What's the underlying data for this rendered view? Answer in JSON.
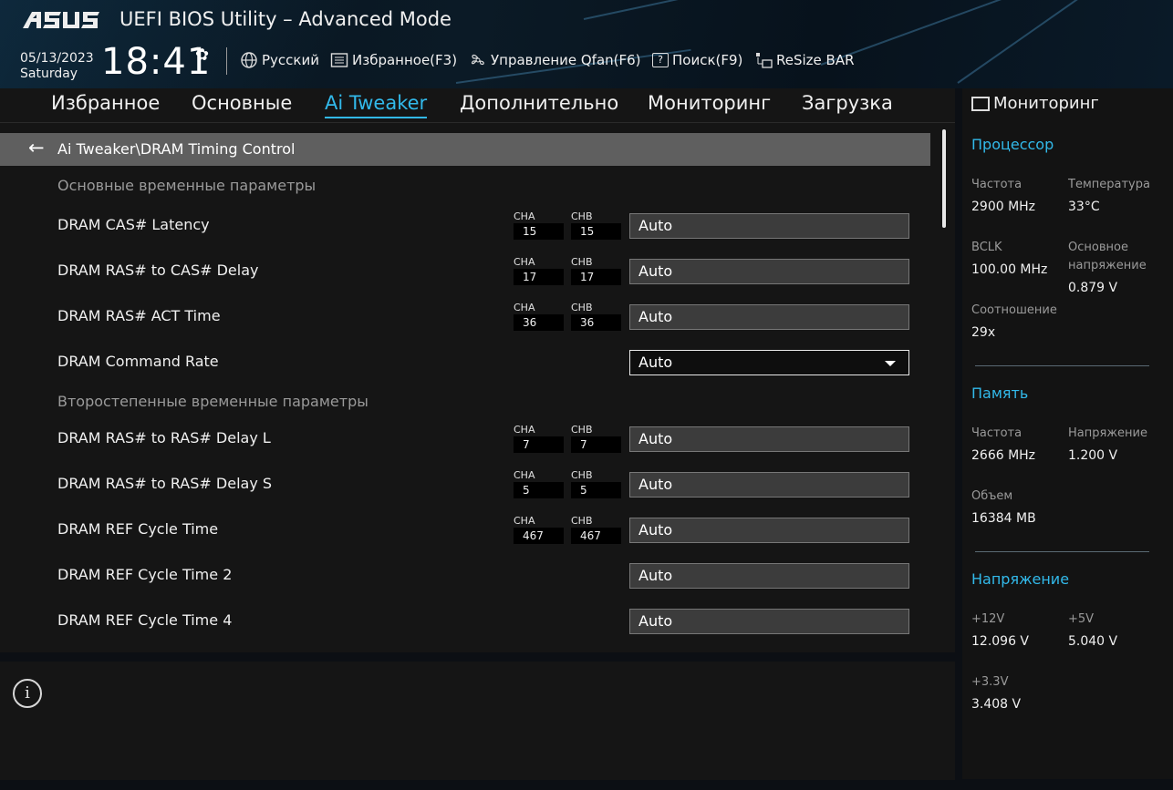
{
  "header": {
    "logo": "/ISUS",
    "title": "UEFI BIOS Utility – Advanced Mode",
    "date": "05/13/2023",
    "day": "Saturday",
    "time": "18:41",
    "tools": {
      "language": "Русский",
      "favorites": "Избранное(F3)",
      "qfan": "Управление Qfan(F6)",
      "search": "Поиск(F9)",
      "resizebar": "ReSize BAR"
    }
  },
  "tabs": [
    "Избранное",
    "Основные",
    "Ai Tweaker",
    "Дополнительно",
    "Мониторинг",
    "Загрузка"
  ],
  "active_tab": "Ai Tweaker",
  "breadcrumb": "Ai Tweaker\\DRAM Timing Control",
  "sections": {
    "primary": "Основные временные параметры",
    "secondary": "Второстепенные временные параметры"
  },
  "rows": [
    {
      "label": "DRAM CAS# Latency",
      "cha": "15",
      "chb": "15",
      "value": "Auto"
    },
    {
      "label": "DRAM RAS# to CAS# Delay",
      "cha": "17",
      "chb": "17",
      "value": "Auto"
    },
    {
      "label": "DRAM RAS# ACT Time",
      "cha": "36",
      "chb": "36",
      "value": "Auto"
    },
    {
      "label": "DRAM Command Rate",
      "value": "Auto"
    },
    {
      "label": "DRAM RAS# to RAS# Delay L",
      "cha": "7",
      "chb": "7",
      "value": "Auto"
    },
    {
      "label": "DRAM RAS# to RAS# Delay S",
      "cha": "5",
      "chb": "5",
      "value": "Auto"
    },
    {
      "label": "DRAM REF Cycle Time",
      "cha": "467",
      "chb": "467",
      "value": "Auto"
    },
    {
      "label": "DRAM REF Cycle Time 2",
      "value": "Auto"
    },
    {
      "label": "DRAM REF Cycle Time 4",
      "value": "Auto"
    }
  ],
  "channel_labels": {
    "a": "CHA",
    "b": "CHB"
  },
  "monitor": {
    "title": "Мониторинг",
    "cpu": {
      "heading": "Процессор",
      "freq_label": "Частота",
      "freq": "2900 MHz",
      "temp_label": "Температура",
      "temp": "33°C",
      "bclk_label": "BCLK",
      "bclk": "100.00 MHz",
      "core_volt_label": "Основное напряжение",
      "core_volt": "0.879 V",
      "ratio_label": "Соотношение",
      "ratio": "29x"
    },
    "memory": {
      "heading": "Память",
      "freq_label": "Частота",
      "freq": "2666 MHz",
      "volt_label": "Напряжение",
      "volt": "1.200 V",
      "size_label": "Объем",
      "size": "16384 MB"
    },
    "voltage": {
      "heading": "Напряжение",
      "v12_label": "+12V",
      "v12": "12.096 V",
      "v5_label": "+5V",
      "v5": "5.040 V",
      "v33_label": "+3.3V",
      "v33": "3.408 V"
    }
  }
}
